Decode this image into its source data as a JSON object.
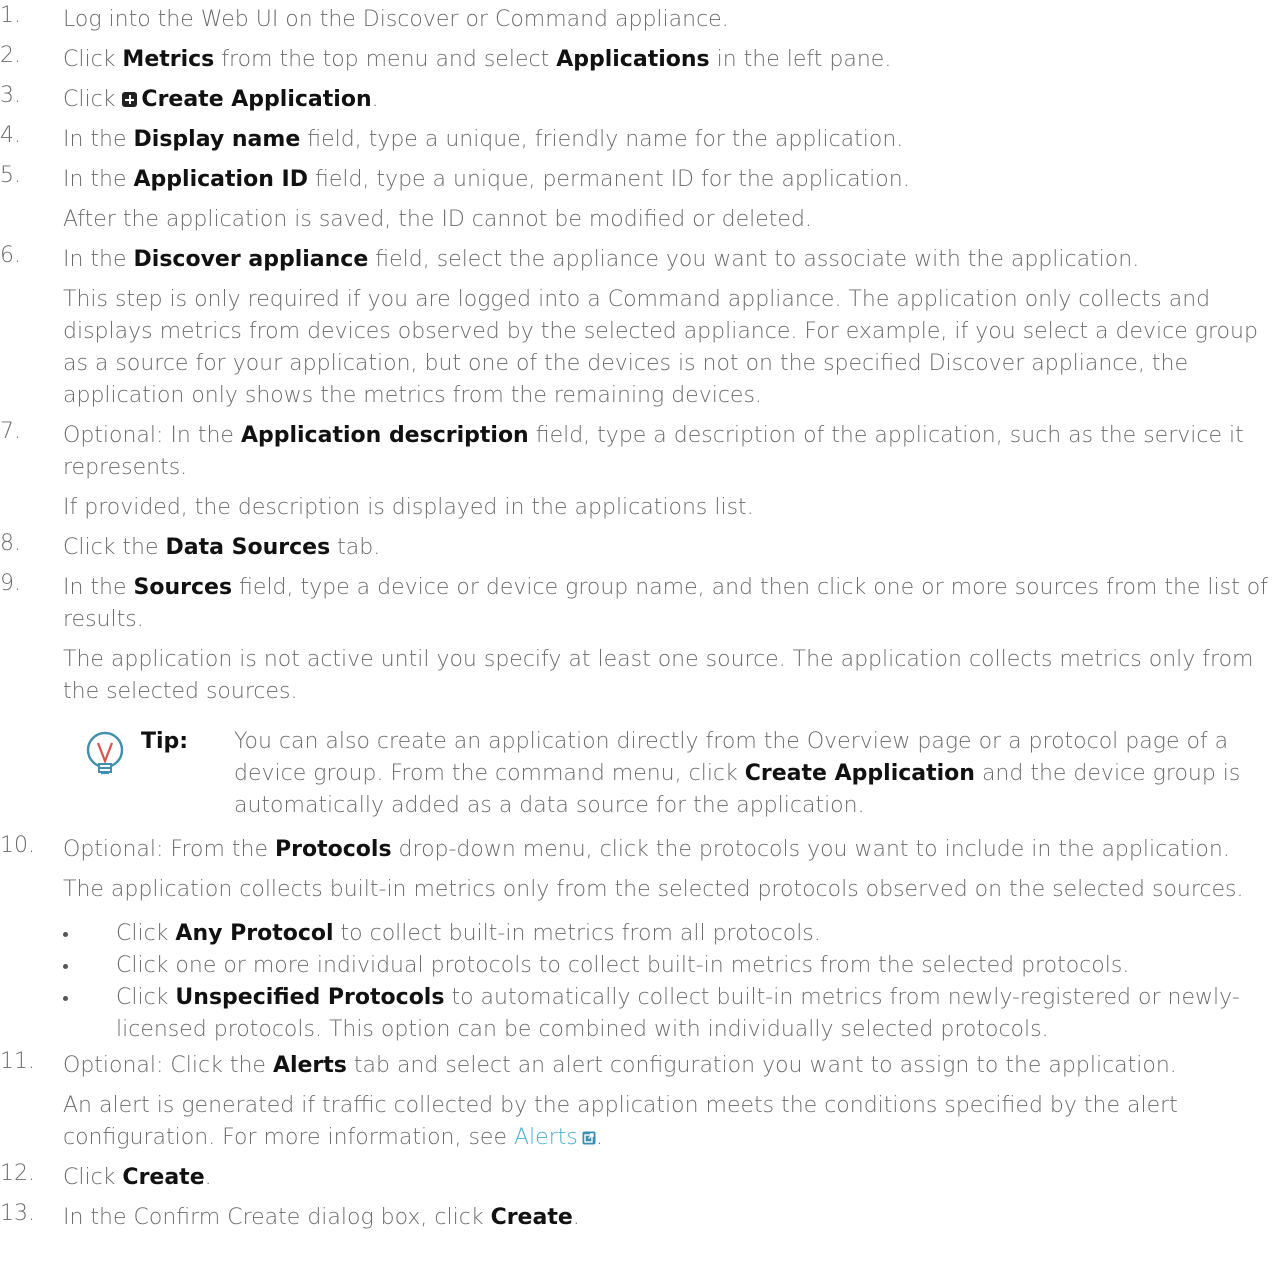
{
  "steps": [
    {
      "num": "1.",
      "parts": [
        {
          "t": "Log into the Web UI on the Discover or Command appliance."
        }
      ]
    },
    {
      "num": "2.",
      "parts": [
        {
          "t": "Click "
        },
        {
          "b": "Metrics"
        },
        {
          "t": " from the top menu and select "
        },
        {
          "b": "Applications"
        },
        {
          "t": " in the left pane."
        }
      ]
    },
    {
      "num": "3.",
      "parts": [
        {
          "t": "Click "
        },
        {
          "icon": "plus-square-icon"
        },
        {
          "b": "Create Application"
        },
        {
          "t": "."
        }
      ]
    },
    {
      "num": "4.",
      "parts": [
        {
          "t": "In the "
        },
        {
          "b": "Display name"
        },
        {
          "t": " field, type a unique, friendly name for the application."
        }
      ]
    },
    {
      "num": "5.",
      "parts": [
        {
          "t": "In the "
        },
        {
          "b": "Application ID"
        },
        {
          "t": " field, type a unique, permanent ID for the application."
        }
      ],
      "note": "After the application is saved, the ID cannot be modified or deleted."
    },
    {
      "num": "6.",
      "parts": [
        {
          "t": "In the "
        },
        {
          "b": "Discover appliance"
        },
        {
          "t": " field, select the appliance you want to associate with the application."
        }
      ],
      "note": "This step is only required if you are logged into a Command appliance. The application only collects and displays metrics from devices observed by the selected appliance. For example, if you select a device group as a source for your application, but one of the devices is not on the specified Discover appliance, the application only shows the metrics from the remaining devices."
    },
    {
      "num": "7.",
      "parts": [
        {
          "t": "Optional: In the "
        },
        {
          "b": "Application description"
        },
        {
          "t": " field, type a description of the application, such as the service it represents."
        }
      ],
      "note": "If provided, the description is displayed in the applications list."
    },
    {
      "num": "8.",
      "parts": [
        {
          "t": "Click the "
        },
        {
          "b": "Data Sources"
        },
        {
          "t": " tab."
        }
      ]
    },
    {
      "num": "9.",
      "parts": [
        {
          "t": "In the "
        },
        {
          "b": "Sources"
        },
        {
          "t": " field, type a device or device group name, and then click one or more sources from the list of results."
        }
      ],
      "note": "The application is not active until you specify at least one source. The application collects metrics only from the selected sources.",
      "tip": {
        "label": "Tip:",
        "parts": [
          {
            "t": "You can also create an application directly from the Overview page or a protocol page of a device group. From the command menu, click "
          },
          {
            "b": "Create Application"
          },
          {
            "t": " and the device group is automatically added as a data source for the application."
          }
        ]
      }
    },
    {
      "num": "10.",
      "parts": [
        {
          "t": "Optional: From the "
        },
        {
          "b": "Protocols"
        },
        {
          "t": " drop-down menu, click the protocols you want to include in the application."
        }
      ],
      "note": "The application collects built-in metrics only from the selected protocols observed on the selected sources.",
      "bullets": [
        [
          {
            "t": "Click "
          },
          {
            "b": "Any Protocol"
          },
          {
            "t": " to collect built-in metrics from all protocols."
          }
        ],
        [
          {
            "t": "Click one or more individual protocols to collect built-in metrics from the selected protocols."
          }
        ],
        [
          {
            "t": "Click "
          },
          {
            "b": "Unspecified Protocols"
          },
          {
            "t": " to automatically collect built-in metrics from newly-registered or newly-licensed protocols. This option can be combined with individually selected protocols."
          }
        ]
      ]
    },
    {
      "num": "11.",
      "parts": [
        {
          "t": "Optional: Click the "
        },
        {
          "b": "Alerts"
        },
        {
          "t": " tab and select an alert configuration you want to assign to the application."
        }
      ],
      "note_parts": [
        {
          "t": "An alert is generated if traffic collected by the application meets the conditions specified by the alert configuration. For more information, see "
        },
        {
          "link": "Alerts"
        },
        {
          "icon": "external-link-icon"
        },
        {
          "t": "."
        }
      ]
    },
    {
      "num": "12.",
      "parts": [
        {
          "t": "Click "
        },
        {
          "b": "Create"
        },
        {
          "t": "."
        }
      ]
    },
    {
      "num": "13.",
      "parts": [
        {
          "t": "In the Confirm Create dialog box, click "
        },
        {
          "b": "Create"
        },
        {
          "t": "."
        }
      ]
    }
  ]
}
